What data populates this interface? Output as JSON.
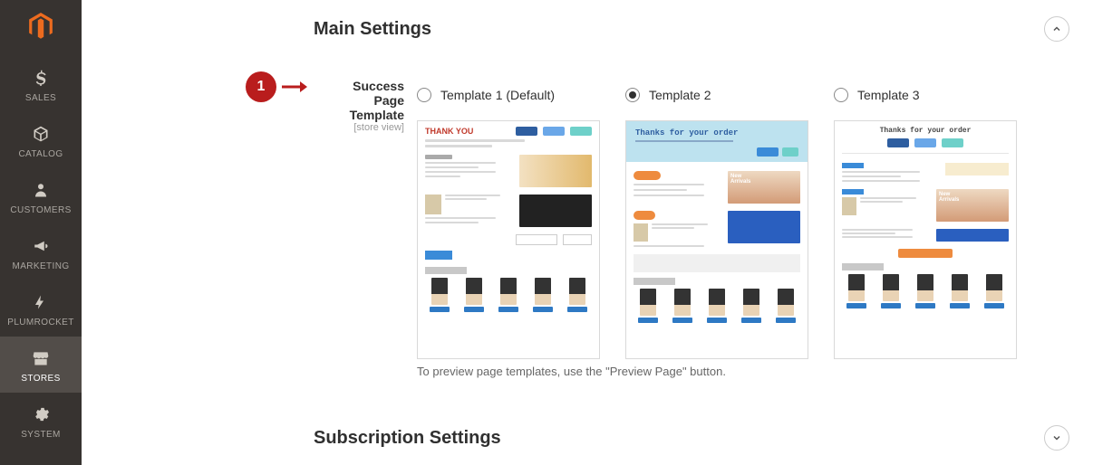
{
  "nav": {
    "items": [
      {
        "label": "SALES"
      },
      {
        "label": "CATALOG"
      },
      {
        "label": "CUSTOMERS"
      },
      {
        "label": "MARKETING"
      },
      {
        "label": "PLUMROCKET"
      },
      {
        "label": "STORES"
      },
      {
        "label": "SYSTEM"
      }
    ]
  },
  "sections": {
    "main_settings": "Main Settings",
    "subscription_settings": "Subscription Settings"
  },
  "step_badge": "1",
  "field": {
    "label_line1": "Success Page",
    "label_line2": "Template",
    "scope": "[store view]"
  },
  "templates": [
    {
      "label": "Template 1 (Default)",
      "selected": false,
      "preview_title": "THANK YOU"
    },
    {
      "label": "Template 2",
      "selected": true,
      "preview_title": "Thanks for your order"
    },
    {
      "label": "Template 3",
      "selected": false,
      "preview_title": "Thanks for your order"
    }
  ],
  "help_text": "To preview page templates, use the \"Preview Page\" button."
}
